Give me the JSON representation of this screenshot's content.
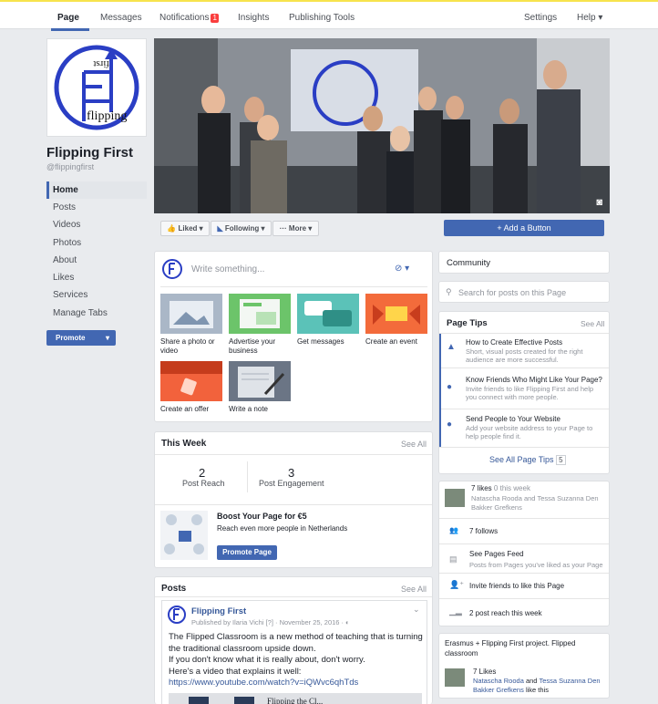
{
  "topnav": {
    "tabs": [
      "Page",
      "Messages",
      "Notifications",
      "Insights",
      "Publishing Tools"
    ],
    "notifications_count": "1",
    "settings": "Settings",
    "help": "Help ▾"
  },
  "sidebar": {
    "page_name": "Flipping First",
    "handle": "@flippingfirst",
    "logo_text": "flipping",
    "logo_text_top": "first",
    "items": [
      "Home",
      "Posts",
      "Videos",
      "Photos",
      "About",
      "Likes",
      "Services",
      "Manage Tabs"
    ],
    "promote": "Promote"
  },
  "actions": {
    "liked": "Liked ▾",
    "following": "Following ▾",
    "more": "··· More ▾",
    "add_button": "+ Add a Button"
  },
  "composer": {
    "placeholder": "Write something...",
    "tiles": [
      "Share a photo or video",
      "Advertise your business",
      "Get messages",
      "Create an event",
      "Create an offer",
      "Write a note"
    ]
  },
  "this_week": {
    "title": "This Week",
    "see_all": "See All",
    "post_reach_value": "2",
    "post_reach_label": "Post Reach",
    "engagement_value": "3",
    "engagement_label": "Post Engagement",
    "boost_title": "Boost Your Page for €5",
    "boost_desc": "Reach even more people in Netherlands",
    "promote_page": "Promote Page"
  },
  "posts": {
    "title": "Posts",
    "see_all": "See All",
    "author": "Flipping First",
    "meta": "Published by Ilaria Vichi [?] · November 25, 2016 · ◐",
    "body": [
      "The Flipped Classroom is a new method of teaching that is turning",
      "the traditional classroom upside down.",
      "If you don't know what it is really about, don't worry.",
      "Here's a video that explains it well:"
    ],
    "link": "https://www.youtube.com/watch?v=iQWvc6qhTds",
    "preview_text": "Flipping the Cl..."
  },
  "community": {
    "title": "Community",
    "search_placeholder": "Search for posts on this Page"
  },
  "page_tips": {
    "title": "Page Tips",
    "see_all": "See All",
    "tips": [
      {
        "title": "How to Create Effective Posts",
        "desc": "Short, visual posts created for the right audience are more successful."
      },
      {
        "title": "Know Friends Who Might Like Your Page?",
        "desc": "Invite friends to like Flipping First and help you connect with more people."
      },
      {
        "title": "Send People to Your Website",
        "desc": "Add your website address to your Page to help people find it."
      }
    ],
    "see_all_tips": "See All Page Tips",
    "tips_count": "5"
  },
  "stats": {
    "likes": "7 likes",
    "likes_week": "0 this week",
    "likers": "Natascha Rooda",
    "and": "and",
    "likers2": "Tessa Suzanna Den Bakker Grefkens",
    "follows": "7 follows",
    "feed_title": "See Pages Feed",
    "feed_desc": "Posts from Pages you've liked as your Page",
    "invite": "Invite friends to like this Page",
    "reach": "2 post reach this week"
  },
  "erasmus": {
    "title": "Erasmus + Flipping First project. Flipped classroom",
    "likes": "7 Likes",
    "name1": "Natascha Rooda",
    "and": "and",
    "name2": "Tessa Suzanna Den Bakker Grefkens",
    "suffix": "like this"
  },
  "colors": {
    "brand": "#4267b2",
    "link": "#365899",
    "badge": "#fa3e3e",
    "topbar_accent": "#f7e34d"
  }
}
